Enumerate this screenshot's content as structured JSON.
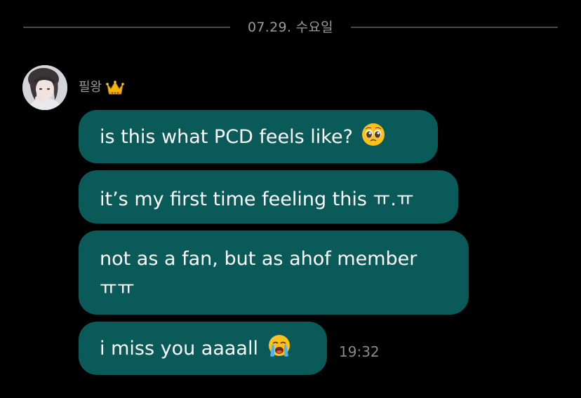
{
  "date_divider": {
    "label": "07.29. 수요일"
  },
  "sender": {
    "name": "필왕",
    "badge_icon": "crown-icon"
  },
  "messages": [
    {
      "text": "is this what PCD feels like?",
      "emoji": "pleading-face-icon"
    },
    {
      "text": "it’s my first time feeling this ㅠ.ㅠ"
    },
    {
      "line1": "not as a fan, but as ahof member",
      "line2": "ㅠㅠ"
    },
    {
      "text": "i miss you aaaall",
      "emoji": "loudly-crying-face-icon"
    }
  ],
  "timestamp": "19:32",
  "colors": {
    "background": "#000000",
    "bubble": "#0a5a5a",
    "divider_line": "#4a4a4a",
    "secondary_text": "#9b9b9b"
  }
}
